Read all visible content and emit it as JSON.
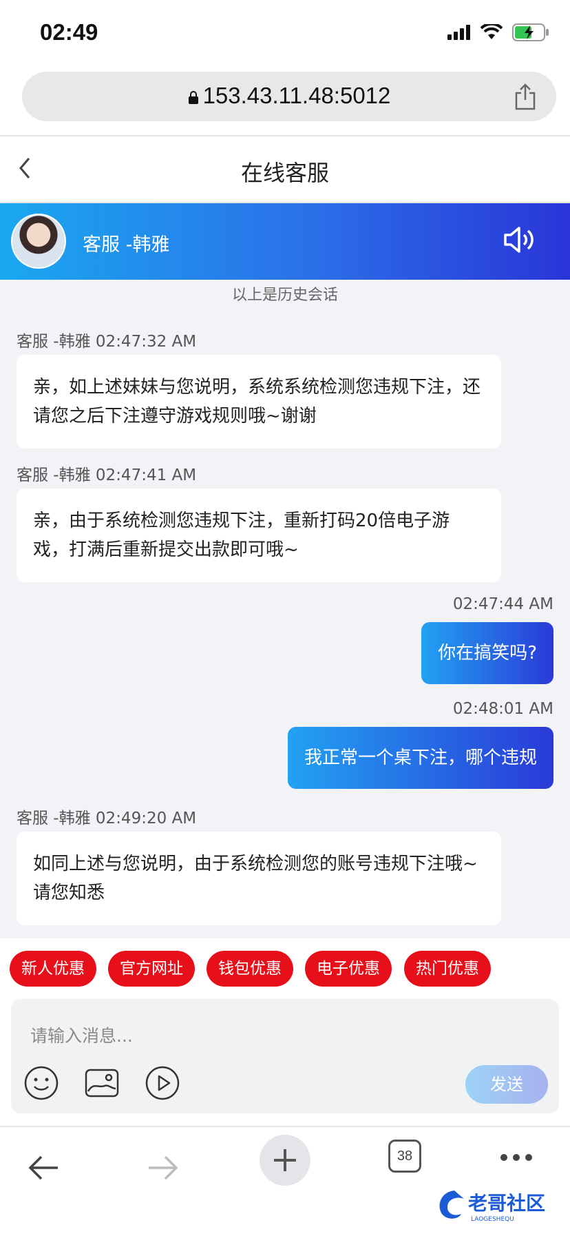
{
  "status": {
    "time": "02:49"
  },
  "browser": {
    "url": "153.43.11.48:5012",
    "tab_count": "38"
  },
  "page": {
    "title": "在线客服"
  },
  "agent": {
    "name": "客服 -韩雅"
  },
  "chat": {
    "history_label": "以上是历史会话",
    "messages": [
      {
        "side": "left",
        "meta": "客服 -韩雅 02:47:32 AM",
        "text": "亲，如上述妹妹与您说明，系统系统检测您违规下注，还请您之后下注遵守游戏规则哦~谢谢"
      },
      {
        "side": "left",
        "meta": "客服 -韩雅 02:47:41 AM",
        "text": "亲，由于系统检测您违规下注，重新打码20倍电子游戏，打满后重新提交出款即可哦~"
      },
      {
        "side": "right",
        "meta": "02:47:44 AM",
        "text": "你在搞笑吗?"
      },
      {
        "side": "right",
        "meta": "02:48:01 AM",
        "text": "我正常一个桌下注，哪个违规"
      },
      {
        "side": "left",
        "meta": "客服 -韩雅 02:49:20 AM",
        "text": "如同上述与您说明，由于系统检测您的账号违规下注哦~请您知悉"
      }
    ]
  },
  "quick_replies": [
    "新人优惠",
    "官方网址",
    "钱包优惠",
    "电子优惠",
    "热门优惠"
  ],
  "composer": {
    "placeholder": "请输入消息...",
    "send_label": "发送"
  },
  "watermark": {
    "text": "老哥社区",
    "sub": "LAOGESHEQU"
  },
  "colors": {
    "header_start": "#1aa8f0",
    "header_end": "#2a35d8",
    "chip": "#e60f1a"
  }
}
